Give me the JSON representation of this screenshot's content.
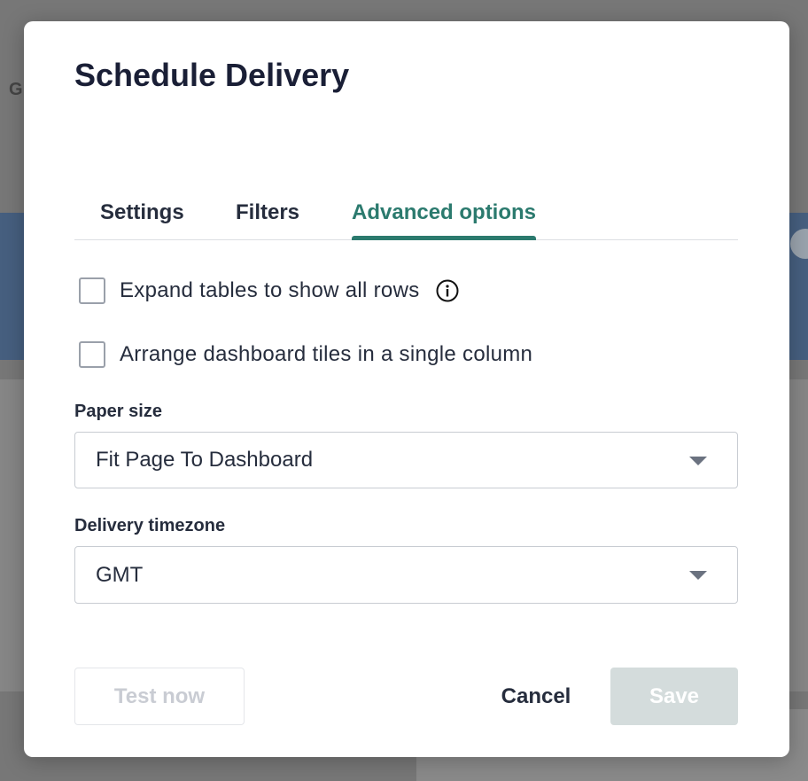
{
  "dialog": {
    "title": "Schedule Delivery",
    "tabs": [
      {
        "label": "Settings",
        "active": false
      },
      {
        "label": "Filters",
        "active": false
      },
      {
        "label": "Advanced options",
        "active": true
      }
    ],
    "options": [
      {
        "label": "Expand tables to show all rows",
        "checked": false,
        "info_icon": "info-icon"
      },
      {
        "label": "Arrange dashboard tiles in a single column",
        "checked": false
      }
    ],
    "paper_size": {
      "label": "Paper size",
      "value": "Fit Page To Dashboard"
    },
    "timezone": {
      "label": "Delivery timezone",
      "value": "GMT"
    },
    "buttons": {
      "test": "Test now",
      "cancel": "Cancel",
      "save": "Save"
    }
  },
  "colors": {
    "accent": "#2b7a6e",
    "text": "#262d3d",
    "save_disabled": "#d4dcdc"
  }
}
